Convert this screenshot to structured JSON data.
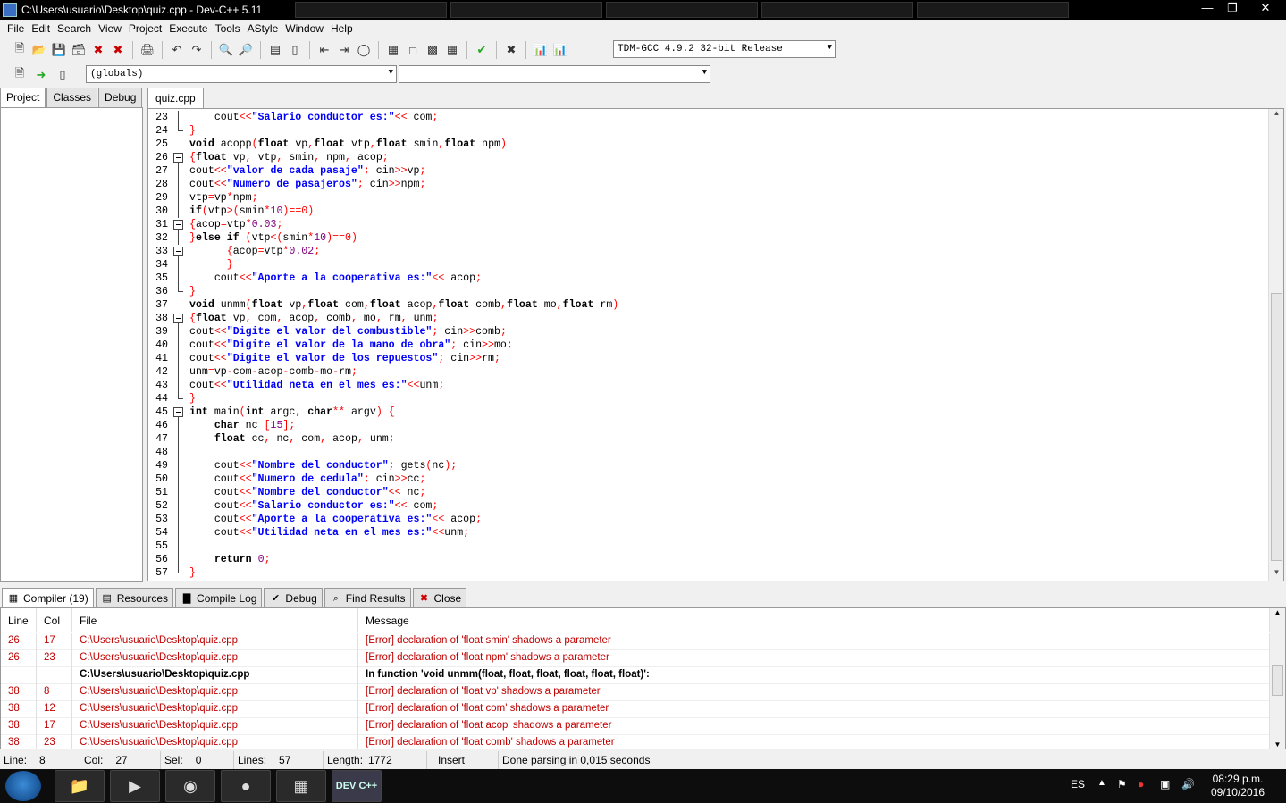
{
  "window": {
    "title": "C:\\Users\\usuario\\Desktop\\quiz.cpp - Dev-C++ 5.11"
  },
  "menu": [
    "File",
    "Edit",
    "Search",
    "View",
    "Project",
    "Execute",
    "Tools",
    "AStyle",
    "Window",
    "Help"
  ],
  "compiler_select": "TDM-GCC 4.9.2 32-bit Release",
  "scope_select": "(globals)",
  "left_tabs": [
    "Project",
    "Classes",
    "Debug"
  ],
  "editor_tab": "quiz.cpp",
  "code": [
    {
      "n": "23",
      "f": "v",
      "t": [
        [
          "",
          "    cout"
        ],
        [
          "op",
          "<<"
        ],
        [
          "str",
          "\"Salario conductor es:\""
        ],
        [
          "op",
          "<<"
        ],
        [
          "",
          " com"
        ],
        [
          "op",
          ";"
        ]
      ]
    },
    {
      "n": "24",
      "f": "e",
      "t": [
        [
          "op",
          "}"
        ]
      ]
    },
    {
      "n": "25",
      "f": "",
      "t": [
        [
          "kw",
          "void"
        ],
        [
          "",
          " acopp"
        ],
        [
          "op",
          "("
        ],
        [
          "kw",
          "float"
        ],
        [
          "",
          " vp"
        ],
        [
          "op",
          ","
        ],
        [
          "kw",
          "float"
        ],
        [
          "",
          " vtp"
        ],
        [
          "op",
          ","
        ],
        [
          "kw",
          "float"
        ],
        [
          "",
          " smin"
        ],
        [
          "op",
          ","
        ],
        [
          "kw",
          "float"
        ],
        [
          "",
          " npm"
        ],
        [
          "op",
          ")"
        ]
      ]
    },
    {
      "n": "26",
      "f": "b",
      "t": [
        [
          "op",
          "{"
        ],
        [
          "kw",
          "float"
        ],
        [
          "",
          " vp"
        ],
        [
          "op",
          ","
        ],
        [
          "",
          " vtp"
        ],
        [
          "op",
          ","
        ],
        [
          "",
          " smin"
        ],
        [
          "op",
          ","
        ],
        [
          "",
          " npm"
        ],
        [
          "op",
          ","
        ],
        [
          "",
          " acop"
        ],
        [
          "op",
          ";"
        ]
      ]
    },
    {
      "n": "27",
      "f": "v",
      "t": [
        [
          "",
          "cout"
        ],
        [
          "op",
          "<<"
        ],
        [
          "str",
          "\"valor de cada pasaje\""
        ],
        [
          "op",
          ";"
        ],
        [
          "",
          " cin"
        ],
        [
          "op",
          ">>"
        ],
        [
          "",
          "vp"
        ],
        [
          "op",
          ";"
        ]
      ]
    },
    {
      "n": "28",
      "f": "v",
      "t": [
        [
          "",
          "cout"
        ],
        [
          "op",
          "<<"
        ],
        [
          "str",
          "\"Numero de pasajeros\""
        ],
        [
          "op",
          ";"
        ],
        [
          "",
          " cin"
        ],
        [
          "op",
          ">>"
        ],
        [
          "",
          "npm"
        ],
        [
          "op",
          ";"
        ]
      ]
    },
    {
      "n": "29",
      "f": "v",
      "t": [
        [
          "",
          "vtp"
        ],
        [
          "op",
          "="
        ],
        [
          "",
          "vp"
        ],
        [
          "op",
          "*"
        ],
        [
          "",
          "npm"
        ],
        [
          "op",
          ";"
        ]
      ]
    },
    {
      "n": "30",
      "f": "v",
      "t": [
        [
          "kw",
          "if"
        ],
        [
          "op",
          "("
        ],
        [
          "",
          "vtp"
        ],
        [
          "op",
          ">("
        ],
        [
          "",
          "smin"
        ],
        [
          "op",
          "*"
        ],
        [
          "num",
          "10"
        ],
        [
          "op",
          ")==0)"
        ]
      ]
    },
    {
      "n": "31",
      "f": "b",
      "t": [
        [
          "op",
          "{"
        ],
        [
          "",
          "acop"
        ],
        [
          "op",
          "="
        ],
        [
          "",
          "vtp"
        ],
        [
          "op",
          "*"
        ],
        [
          "num",
          "0.03"
        ],
        [
          "op",
          ";"
        ]
      ]
    },
    {
      "n": "32",
      "f": "v",
      "t": [
        [
          "op",
          "}"
        ],
        [
          "kw",
          "else if"
        ],
        [
          "",
          " "
        ],
        [
          "op",
          "("
        ],
        [
          "",
          "vtp"
        ],
        [
          "op",
          "<("
        ],
        [
          "",
          "smin"
        ],
        [
          "op",
          "*"
        ],
        [
          "num",
          "10"
        ],
        [
          "op",
          ")==0)"
        ]
      ]
    },
    {
      "n": "33",
      "f": "b",
      "t": [
        [
          "",
          "      "
        ],
        [
          "op",
          "{"
        ],
        [
          "",
          "acop"
        ],
        [
          "op",
          "="
        ],
        [
          "",
          "vtp"
        ],
        [
          "op",
          "*"
        ],
        [
          "num",
          "0.02"
        ],
        [
          "op",
          ";"
        ]
      ]
    },
    {
      "n": "34",
      "f": "v",
      "t": [
        [
          "",
          "      "
        ],
        [
          "op",
          "}"
        ]
      ]
    },
    {
      "n": "35",
      "f": "v",
      "t": [
        [
          "",
          "    cout"
        ],
        [
          "op",
          "<<"
        ],
        [
          "str",
          "\"Aporte a la cooperativa es:\""
        ],
        [
          "op",
          "<<"
        ],
        [
          "",
          " acop"
        ],
        [
          "op",
          ";"
        ]
      ]
    },
    {
      "n": "36",
      "f": "e",
      "t": [
        [
          "op",
          "}"
        ]
      ]
    },
    {
      "n": "37",
      "f": "",
      "t": [
        [
          "kw",
          "void"
        ],
        [
          "",
          " unmm"
        ],
        [
          "op",
          "("
        ],
        [
          "kw",
          "float"
        ],
        [
          "",
          " vp"
        ],
        [
          "op",
          ","
        ],
        [
          "kw",
          "float"
        ],
        [
          "",
          " com"
        ],
        [
          "op",
          ","
        ],
        [
          "kw",
          "float"
        ],
        [
          "",
          " acop"
        ],
        [
          "op",
          ","
        ],
        [
          "kw",
          "float"
        ],
        [
          "",
          " comb"
        ],
        [
          "op",
          ","
        ],
        [
          "kw",
          "float"
        ],
        [
          "",
          " mo"
        ],
        [
          "op",
          ","
        ],
        [
          "kw",
          "float"
        ],
        [
          "",
          " rm"
        ],
        [
          "op",
          ")"
        ]
      ]
    },
    {
      "n": "38",
      "f": "b",
      "t": [
        [
          "op",
          "{"
        ],
        [
          "kw",
          "float"
        ],
        [
          "",
          " vp"
        ],
        [
          "op",
          ","
        ],
        [
          "",
          " com"
        ],
        [
          "op",
          ","
        ],
        [
          "",
          " acop"
        ],
        [
          "op",
          ","
        ],
        [
          "",
          " comb"
        ],
        [
          "op",
          ","
        ],
        [
          "",
          " mo"
        ],
        [
          "op",
          ","
        ],
        [
          "",
          " rm"
        ],
        [
          "op",
          ","
        ],
        [
          "",
          " unm"
        ],
        [
          "op",
          ";"
        ]
      ]
    },
    {
      "n": "39",
      "f": "v",
      "t": [
        [
          "",
          "cout"
        ],
        [
          "op",
          "<<"
        ],
        [
          "str",
          "\"Digite el valor del combustible\""
        ],
        [
          "op",
          ";"
        ],
        [
          "",
          " cin"
        ],
        [
          "op",
          ">>"
        ],
        [
          "",
          "comb"
        ],
        [
          "op",
          ";"
        ]
      ]
    },
    {
      "n": "40",
      "f": "v",
      "t": [
        [
          "",
          "cout"
        ],
        [
          "op",
          "<<"
        ],
        [
          "str",
          "\"Digite el valor de la mano de obra\""
        ],
        [
          "op",
          ";"
        ],
        [
          "",
          " cin"
        ],
        [
          "op",
          ">>"
        ],
        [
          "",
          "mo"
        ],
        [
          "op",
          ";"
        ]
      ]
    },
    {
      "n": "41",
      "f": "v",
      "t": [
        [
          "",
          "cout"
        ],
        [
          "op",
          "<<"
        ],
        [
          "str",
          "\"Digite el valor de los repuestos\""
        ],
        [
          "op",
          ";"
        ],
        [
          "",
          " cin"
        ],
        [
          "op",
          ">>"
        ],
        [
          "",
          "rm"
        ],
        [
          "op",
          ";"
        ]
      ]
    },
    {
      "n": "42",
      "f": "v",
      "t": [
        [
          "",
          "unm"
        ],
        [
          "op",
          "="
        ],
        [
          "",
          "vp"
        ],
        [
          "op",
          "-"
        ],
        [
          "",
          "com"
        ],
        [
          "op",
          "-"
        ],
        [
          "",
          "acop"
        ],
        [
          "op",
          "-"
        ],
        [
          "",
          "comb"
        ],
        [
          "op",
          "-"
        ],
        [
          "",
          "mo"
        ],
        [
          "op",
          "-"
        ],
        [
          "",
          "rm"
        ],
        [
          "op",
          ";"
        ]
      ]
    },
    {
      "n": "43",
      "f": "v",
      "t": [
        [
          "",
          "cout"
        ],
        [
          "op",
          "<<"
        ],
        [
          "str",
          "\"Utilidad neta en el mes es:\""
        ],
        [
          "op",
          "<<"
        ],
        [
          "",
          "unm"
        ],
        [
          "op",
          ";"
        ]
      ]
    },
    {
      "n": "44",
      "f": "e",
      "t": [
        [
          "op",
          "}"
        ]
      ]
    },
    {
      "n": "45",
      "f": "b",
      "t": [
        [
          "kw",
          "int"
        ],
        [
          "",
          " main"
        ],
        [
          "op",
          "("
        ],
        [
          "kw",
          "int"
        ],
        [
          "",
          " argc"
        ],
        [
          "op",
          ","
        ],
        [
          "",
          " "
        ],
        [
          "kw",
          "char"
        ],
        [
          "op",
          "**"
        ],
        [
          "",
          " argv"
        ],
        [
          "op",
          ")"
        ],
        [
          "",
          " "
        ],
        [
          "op",
          "{"
        ]
      ]
    },
    {
      "n": "46",
      "f": "v",
      "t": [
        [
          "",
          "    "
        ],
        [
          "kw",
          "char"
        ],
        [
          "",
          " nc "
        ],
        [
          "op",
          "["
        ],
        [
          "num",
          "15"
        ],
        [
          "op",
          "];"
        ]
      ]
    },
    {
      "n": "47",
      "f": "v",
      "t": [
        [
          "",
          "    "
        ],
        [
          "kw",
          "float"
        ],
        [
          "",
          " cc"
        ],
        [
          "op",
          ","
        ],
        [
          "",
          " nc"
        ],
        [
          "op",
          ","
        ],
        [
          "",
          " com"
        ],
        [
          "op",
          ","
        ],
        [
          "",
          " acop"
        ],
        [
          "op",
          ","
        ],
        [
          "",
          " unm"
        ],
        [
          "op",
          ";"
        ]
      ]
    },
    {
      "n": "48",
      "f": "v",
      "t": []
    },
    {
      "n": "49",
      "f": "v",
      "t": [
        [
          "",
          "    cout"
        ],
        [
          "op",
          "<<"
        ],
        [
          "str",
          "\"Nombre del conductor\""
        ],
        [
          "op",
          ";"
        ],
        [
          "",
          " gets"
        ],
        [
          "op",
          "("
        ],
        [
          "",
          "nc"
        ],
        [
          "op",
          ");"
        ]
      ]
    },
    {
      "n": "50",
      "f": "v",
      "t": [
        [
          "",
          "    cout"
        ],
        [
          "op",
          "<<"
        ],
        [
          "str",
          "\"Numero de cedula\""
        ],
        [
          "op",
          ";"
        ],
        [
          "",
          " cin"
        ],
        [
          "op",
          ">>"
        ],
        [
          "",
          "cc"
        ],
        [
          "op",
          ";"
        ]
      ]
    },
    {
      "n": "51",
      "f": "v",
      "t": [
        [
          "",
          "    cout"
        ],
        [
          "op",
          "<<"
        ],
        [
          "str",
          "\"Nombre del conductor\""
        ],
        [
          "op",
          "<<"
        ],
        [
          "",
          " nc"
        ],
        [
          "op",
          ";"
        ]
      ]
    },
    {
      "n": "52",
      "f": "v",
      "t": [
        [
          "",
          "    cout"
        ],
        [
          "op",
          "<<"
        ],
        [
          "str",
          "\"Salario conductor es:\""
        ],
        [
          "op",
          "<<"
        ],
        [
          "",
          " com"
        ],
        [
          "op",
          ";"
        ]
      ]
    },
    {
      "n": "53",
      "f": "v",
      "t": [
        [
          "",
          "    cout"
        ],
        [
          "op",
          "<<"
        ],
        [
          "str",
          "\"Aporte a la cooperativa es:\""
        ],
        [
          "op",
          "<<"
        ],
        [
          "",
          " acop"
        ],
        [
          "op",
          ";"
        ]
      ]
    },
    {
      "n": "54",
      "f": "v",
      "t": [
        [
          "",
          "    cout"
        ],
        [
          "op",
          "<<"
        ],
        [
          "str",
          "\"Utilidad neta en el mes es:\""
        ],
        [
          "op",
          "<<"
        ],
        [
          "",
          "unm"
        ],
        [
          "op",
          ";"
        ]
      ]
    },
    {
      "n": "55",
      "f": "v",
      "t": []
    },
    {
      "n": "56",
      "f": "v",
      "t": [
        [
          "",
          "    "
        ],
        [
          "kw",
          "return"
        ],
        [
          "",
          " "
        ],
        [
          "num",
          "0"
        ],
        [
          "op",
          ";"
        ]
      ]
    },
    {
      "n": "57",
      "f": "e",
      "t": [
        [
          "op",
          "}"
        ]
      ]
    }
  ],
  "bottom_tabs": [
    {
      "icon": "compiler-icon",
      "label": "Compiler (19)"
    },
    {
      "icon": "resources-icon",
      "label": "Resources"
    },
    {
      "icon": "compile-log-icon",
      "label": "Compile Log"
    },
    {
      "icon": "debug-icon",
      "label": "Debug"
    },
    {
      "icon": "find-results-icon",
      "label": "Find Results"
    },
    {
      "icon": "close-icon",
      "label": "Close"
    }
  ],
  "messages": {
    "headers": [
      "Line",
      "Col",
      "File",
      "Message"
    ],
    "rows": [
      {
        "line": "26",
        "col": "17",
        "file": "C:\\Users\\usuario\\Desktop\\quiz.cpp",
        "msg": "[Error] declaration of 'float smin' shadows a parameter",
        "type": "err"
      },
      {
        "line": "26",
        "col": "23",
        "file": "C:\\Users\\usuario\\Desktop\\quiz.cpp",
        "msg": "[Error] declaration of 'float npm' shadows a parameter",
        "type": "err"
      },
      {
        "line": "",
        "col": "",
        "file": "C:\\Users\\usuario\\Desktop\\quiz.cpp",
        "msg": "In function 'void unmm(float, float, float, float, float, float)':",
        "type": "bold"
      },
      {
        "line": "38",
        "col": "8",
        "file": "C:\\Users\\usuario\\Desktop\\quiz.cpp",
        "msg": "[Error] declaration of 'float vp' shadows a parameter",
        "type": "err"
      },
      {
        "line": "38",
        "col": "12",
        "file": "C:\\Users\\usuario\\Desktop\\quiz.cpp",
        "msg": "[Error] declaration of 'float com' shadows a parameter",
        "type": "err"
      },
      {
        "line": "38",
        "col": "17",
        "file": "C:\\Users\\usuario\\Desktop\\quiz.cpp",
        "msg": "[Error] declaration of 'float acop' shadows a parameter",
        "type": "err"
      },
      {
        "line": "38",
        "col": "23",
        "file": "C:\\Users\\usuario\\Desktop\\quiz.cpp",
        "msg": "[Error] declaration of 'float comb' shadows a parameter",
        "type": "err"
      }
    ]
  },
  "status": {
    "line_label": "Line:",
    "line": "8",
    "col_label": "Col:",
    "col": "27",
    "sel_label": "Sel:",
    "sel": "0",
    "lines_label": "Lines:",
    "lines": "57",
    "length_label": "Length:",
    "length": "1772",
    "mode": "Insert",
    "message": "Done parsing in 0,015 seconds"
  },
  "taskbar": {
    "lang": "ES",
    "time": "08:29 p.m.",
    "date": "09/10/2016",
    "devcpp_label": "DEV C++"
  }
}
